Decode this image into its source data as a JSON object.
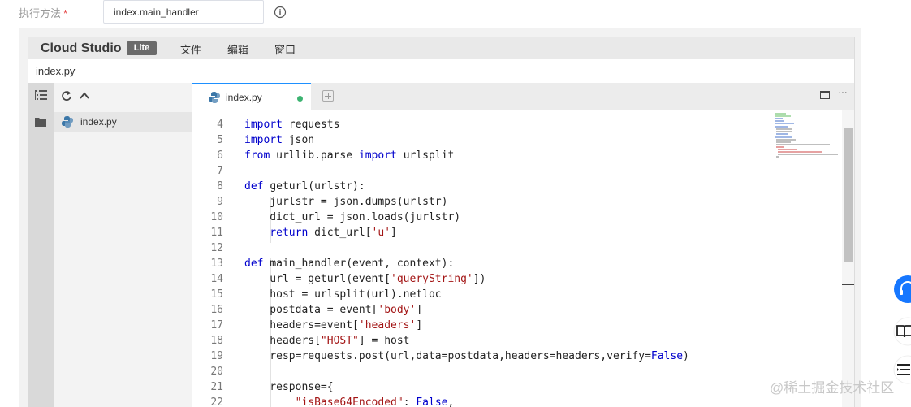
{
  "form": {
    "label": "执行方法",
    "required_mark": "*",
    "handler_value": "index.main_handler"
  },
  "ide": {
    "brand": "Cloud Studio",
    "badge": "Lite",
    "menu": [
      "文件",
      "编辑",
      "窗口"
    ],
    "title": "index.py",
    "explorer_file": "index.py",
    "tab_name": "index.py",
    "tab_modified_color": "#3cb371"
  },
  "code_lines": [
    {
      "n": "4",
      "t": [
        [
          "kw",
          "import"
        ],
        [
          "",
          "requests"
        ]
      ]
    },
    {
      "n": "5",
      "t": [
        [
          "kw",
          "import"
        ],
        [
          "",
          "json"
        ]
      ]
    },
    {
      "n": "6",
      "t": [
        [
          "kw",
          "from"
        ],
        [
          "",
          "urllib.parse "
        ],
        [
          "kw",
          "import"
        ],
        [
          "",
          "urlsplit"
        ]
      ]
    },
    {
      "n": "7",
      "t": []
    },
    {
      "n": "8",
      "t": [
        [
          "kw",
          "def"
        ],
        [
          "",
          "geturl(urlstr):"
        ]
      ]
    },
    {
      "n": "9",
      "t": [
        [
          "",
          "    jurlstr = json.dumps(urlstr)"
        ]
      ]
    },
    {
      "n": "10",
      "t": [
        [
          "",
          "    dict_url = json.loads(jurlstr)"
        ]
      ]
    },
    {
      "n": "11",
      "t": [
        [
          "kw",
          "    return"
        ],
        [
          "",
          "dict_url["
        ],
        [
          "str",
          "'u'"
        ],
        [
          "",
          "]"
        ]
      ]
    },
    {
      "n": "12",
      "t": []
    },
    {
      "n": "13",
      "t": [
        [
          "kw",
          "def"
        ],
        [
          "",
          "main_handler(event, context):"
        ]
      ]
    },
    {
      "n": "14",
      "t": [
        [
          "",
          "    url = geturl(event["
        ],
        [
          "str",
          "'queryString'"
        ],
        [
          "",
          "])"
        ]
      ]
    },
    {
      "n": "15",
      "t": [
        [
          "",
          "    host = urlsplit(url).netloc"
        ]
      ]
    },
    {
      "n": "16",
      "t": [
        [
          "",
          "    postdata = event["
        ],
        [
          "str",
          "'body'"
        ],
        [
          "",
          "]"
        ]
      ]
    },
    {
      "n": "17",
      "t": [
        [
          "",
          "    headers=event["
        ],
        [
          "str",
          "'headers'"
        ],
        [
          "",
          "]"
        ]
      ]
    },
    {
      "n": "18",
      "t": [
        [
          "",
          "    headers["
        ],
        [
          "str",
          "\"HOST\""
        ],
        [
          "",
          "] = host"
        ]
      ]
    },
    {
      "n": "19",
      "t": [
        [
          "",
          "    resp=requests.post(url,data=postdata,headers=headers,verify="
        ],
        [
          "kw",
          "False"
        ],
        [
          "",
          ")"
        ]
      ]
    },
    {
      "n": "20",
      "t": []
    },
    {
      "n": "21",
      "t": [
        [
          "",
          "    response={"
        ]
      ]
    },
    {
      "n": "22",
      "t": [
        [
          "",
          "        "
        ],
        [
          "str",
          "\"isBase64Encoded\""
        ],
        [
          "",
          ": "
        ],
        [
          "kw",
          "False"
        ],
        [
          "",
          ","
        ]
      ]
    }
  ],
  "watermark": "@稀土掘金技术社区",
  "colors": {
    "keyword": "#0000cc",
    "string": "#a31515",
    "accent": "#1e90ff",
    "float_button": "#1677ff"
  }
}
